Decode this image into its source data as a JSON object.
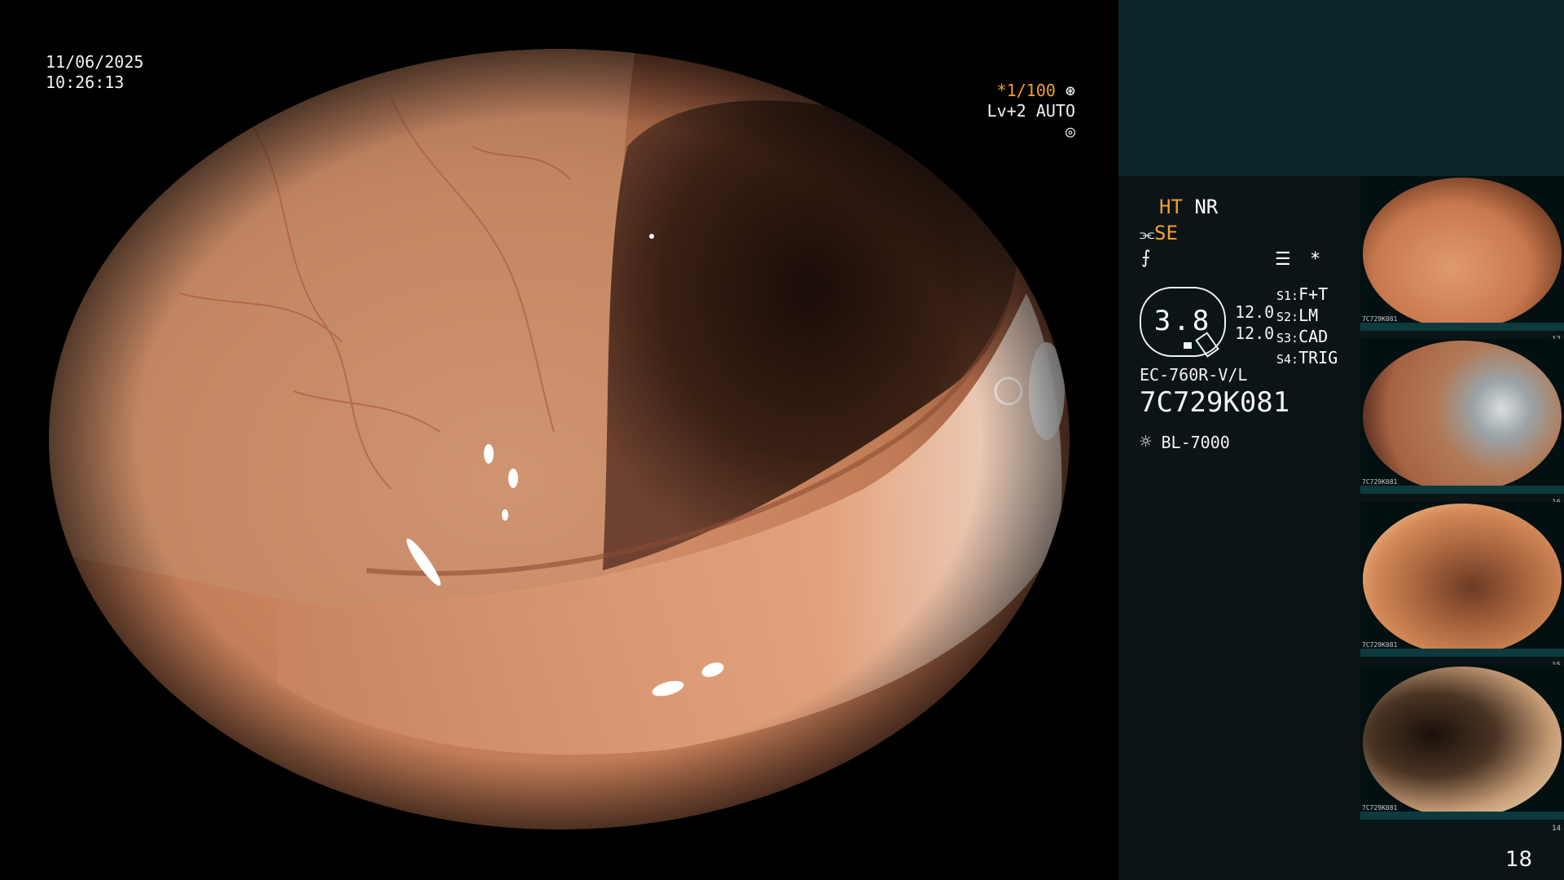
{
  "osd": {
    "date": "11/06/2025",
    "time": "10:26:13",
    "shutter": "*1/100",
    "level": "Lv+2 AUTO"
  },
  "panel": {
    "ht": "HT",
    "nr": "NR",
    "se": "SE",
    "settings_star": "*",
    "zoom": "3.8",
    "value_a": "12.0",
    "value_b": "12.0",
    "switches": [
      {
        "key": "S1:",
        "value": "F+T"
      },
      {
        "key": "S2:",
        "value": "LM"
      },
      {
        "key": "S3:",
        "value": "CAD"
      },
      {
        "key": "S4:",
        "value": "TRIG"
      }
    ],
    "scope_model": "EC-760R-V/L",
    "scope_serial": "7C729K081",
    "light_source": "BL-7000"
  },
  "thumbnails": [
    {
      "name": "thumb-1",
      "number": "17",
      "serial": "7C729K081"
    },
    {
      "name": "thumb-2",
      "number": "16",
      "serial": "7C729K081"
    },
    {
      "name": "thumb-3",
      "number": "15",
      "serial": "7C729K081"
    },
    {
      "name": "thumb-4",
      "number": "14",
      "serial": "7C729K081"
    }
  ],
  "page_number": "18",
  "colors": {
    "mucosa": "#c9825c",
    "lumen": "#2a1610",
    "panel_top": "#0a2628",
    "panel_body": "#0b1416",
    "accent": "#f0a030"
  }
}
